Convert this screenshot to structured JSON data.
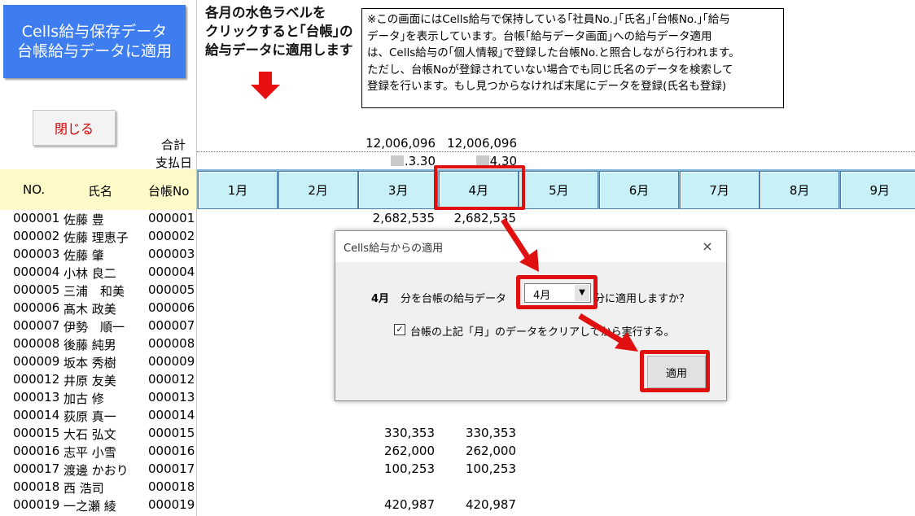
{
  "buttons": {
    "apply_line1": "Cells給与保存データ",
    "apply_line2": "台帳給与データに適用",
    "close": "閉じる"
  },
  "instruction": {
    "line1": "各月の水色ラベルを",
    "line2": "クリックすると｢台帳｣の",
    "line3": "給与データに適用します"
  },
  "note": {
    "line1": "※この画面にはCells給与で保持している｢社員No.｣｢氏名｣｢台帳No.｣｢給与",
    "line2": "データ｣を表示しています。台帳｢給与データ画面｣への給与データ適用",
    "line3": "は、Cells給与の｢個人情報｣で登録した台帳No.と照合しながら行われます。",
    "line4": "ただし、台帳Noが登録されていない場合でも同じ氏名のデータを検索して",
    "line5": "登録を行います。もし見つからなければ末尾にデータを登録(氏名も登録)"
  },
  "summary": {
    "total_label": "合計",
    "paydate_label": "支払日",
    "total_m3": "12,006,096",
    "total_m4": "12,006,096",
    "paydate_m3": ".3.30",
    "paydate_m4": "4.30"
  },
  "table": {
    "headers": {
      "no": "NO.",
      "name": "氏名",
      "ledger": "台帳No"
    },
    "months": [
      "1月",
      "2月",
      "3月",
      "4月",
      "5月",
      "6月",
      "7月",
      "8月",
      "9月"
    ],
    "rows": [
      {
        "no": "000001",
        "name": "佐藤 豊",
        "ledger": "000001",
        "m3": "2,682,535",
        "m4": "2,682,535"
      },
      {
        "no": "000002",
        "name": "佐藤 理恵子",
        "ledger": "000002",
        "m3": "",
        "m4": ""
      },
      {
        "no": "000003",
        "name": "佐藤 肇",
        "ledger": "000003",
        "m3": "",
        "m4": ""
      },
      {
        "no": "000004",
        "name": "小林 良二",
        "ledger": "000004",
        "m3": "",
        "m4": ""
      },
      {
        "no": "000005",
        "name": "三浦　和美",
        "ledger": "000005",
        "m3": "",
        "m4": ""
      },
      {
        "no": "000006",
        "name": "髙木 政美",
        "ledger": "000006",
        "m3": "",
        "m4": ""
      },
      {
        "no": "000007",
        "name": "伊勢　順一",
        "ledger": "000007",
        "m3": "",
        "m4": ""
      },
      {
        "no": "000008",
        "name": "後藤 純男",
        "ledger": "000008",
        "m3": "",
        "m4": ""
      },
      {
        "no": "000009",
        "name": "坂本 秀樹",
        "ledger": "000009",
        "m3": "",
        "m4": ""
      },
      {
        "no": "000012",
        "name": "井原 友美",
        "ledger": "000012",
        "m3": "",
        "m4": ""
      },
      {
        "no": "000013",
        "name": "加古 修",
        "ledger": "000013",
        "m3": "",
        "m4": ""
      },
      {
        "no": "000014",
        "name": "荻原 真一",
        "ledger": "000014",
        "m3": "",
        "m4": ""
      },
      {
        "no": "000015",
        "name": "大石 弘文",
        "ledger": "000015",
        "m3": "330,353",
        "m4": "330,353"
      },
      {
        "no": "000016",
        "name": "志平 小雪",
        "ledger": "000016",
        "m3": "262,000",
        "m4": "262,000"
      },
      {
        "no": "000017",
        "name": "渡邊 かおり",
        "ledger": "000017",
        "m3": "100,253",
        "m4": "100,253"
      },
      {
        "no": "000018",
        "name": "西 浩司",
        "ledger": "000018",
        "m3": "",
        "m4": ""
      },
      {
        "no": "000019",
        "name": "一之瀬 綾",
        "ledger": "000019",
        "m3": "420,987",
        "m4": "420,987"
      }
    ]
  },
  "dialog": {
    "title": "Cells給与からの適用",
    "close_symbol": "×",
    "month_bold": "4月",
    "text_before": "分を台帳の給与データ",
    "select_value": "4月",
    "select_arrow": "▼",
    "text_after": "分に適用しますか？",
    "checkbox_checked": true,
    "checkbox_mark": "✓",
    "checkbox_label": "台帳の上記「月」のデータをクリアしてから実行する。",
    "apply_button": "適用"
  },
  "colors": {
    "apply_button_bg": "#3d7df0",
    "month_label_bg": "#c8f0f7",
    "header_left_bg": "#fdfac8",
    "highlight_red": "#e01010",
    "close_text": "#d60000"
  }
}
